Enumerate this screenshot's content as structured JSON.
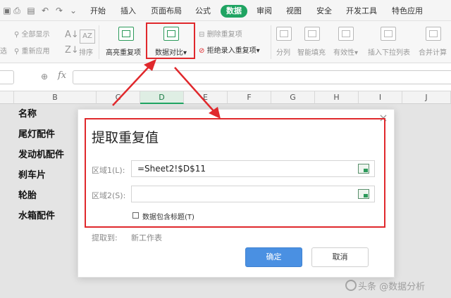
{
  "menubar": {
    "tabs": [
      "开始",
      "插入",
      "页面布局",
      "公式",
      "数据",
      "审阅",
      "视图",
      "安全",
      "开发工具",
      "特色应用"
    ],
    "active_tab": "数据"
  },
  "ribbon": {
    "show_all": "全部显示",
    "reapply": "重新应用",
    "filter_short": "选",
    "sort": "排序",
    "highlight_duplicates": "高亮重复项",
    "data_compare": "数据对比",
    "delete_duplicates": "删除重复项",
    "reject_duplicates": "拒绝录入重复项",
    "split": "分列",
    "smart_fill": "智能填充",
    "validity": "有效性",
    "insert_dropdown": "插入下拉列表",
    "merge_calc": "合并计算"
  },
  "formula_bar": {
    "fx_label": "fx"
  },
  "columns": [
    "B",
    "C",
    "D",
    "E",
    "F",
    "G",
    "H",
    "I",
    "J"
  ],
  "selected_column": "D",
  "cells": [
    "名称",
    "尾灯配件",
    "发动机配件",
    "刹车片",
    "轮胎",
    "水箱配件"
  ],
  "dialog": {
    "title": "提取重复值",
    "range1_label": "区域1(L):",
    "range1_value": "=Sheet2!$D$11",
    "range2_label": "区域2(S):",
    "range2_value": "",
    "checkbox_label": "数据包含标题(T)",
    "extract_to_label": "提取到:",
    "extract_to_value": "新工作表",
    "ok": "确定",
    "cancel": "取消",
    "close_glyph": "×"
  },
  "watermark": "头条 @数据分析",
  "colors": {
    "accent_green": "#1fa462",
    "annotation_red": "#e0282c",
    "ok_blue": "#4a90e2"
  }
}
